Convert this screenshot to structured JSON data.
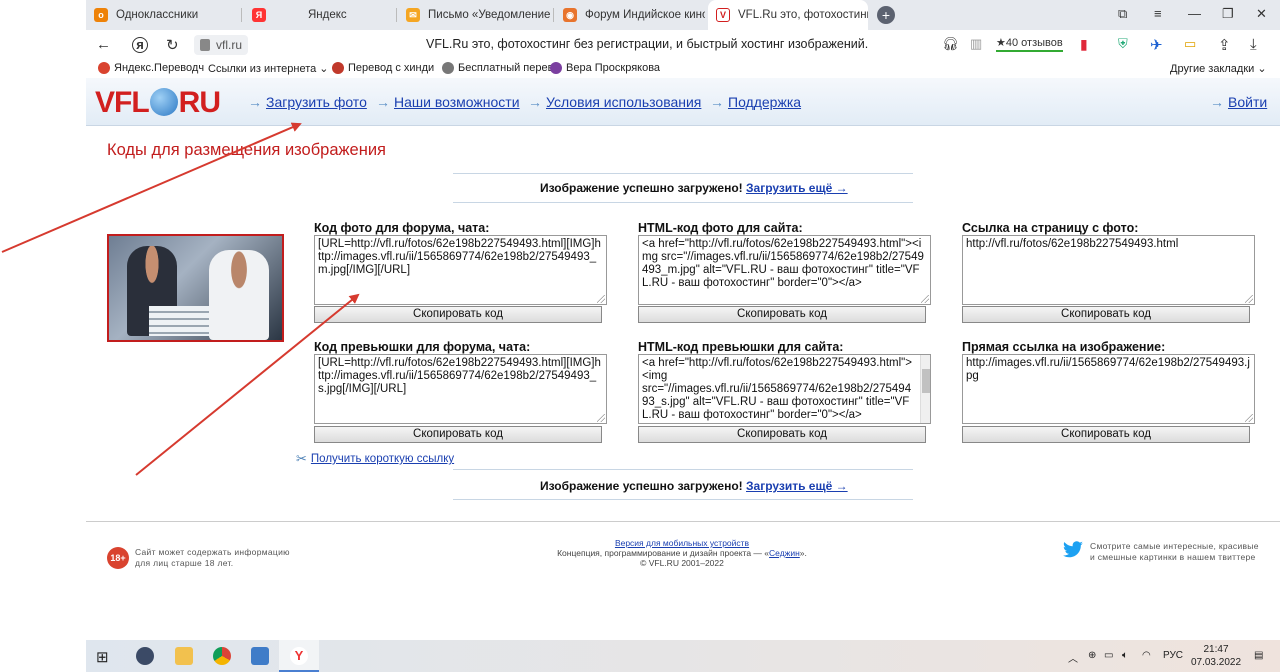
{
  "browser": {
    "tabs": [
      {
        "label": "Одноклассники",
        "icon": "ok-icon",
        "color": "#ee8208"
      },
      {
        "label": "Яндекс",
        "icon": "yandex-icon",
        "color": "#f33"
      },
      {
        "label": "Письмо «Уведомление об",
        "icon": "mail-icon",
        "color": "#f5a623"
      },
      {
        "label": "Форум Индийское кино",
        "icon": "forum-icon",
        "color": "#e8742d"
      },
      {
        "label": "VFL.Ru это, фотохостинг",
        "icon": "vfl-icon",
        "color": "#d21f1f",
        "active": true
      }
    ],
    "new_tab": "+",
    "url": "vfl.ru",
    "page_title": "VFL.Ru это, фотохостинг без регистрации, и быстрый хостинг изображений.",
    "reviews": "★40 отзывов",
    "bookmarks": [
      {
        "label": "Яндекс.Переводч",
        "color": "#d9432f"
      },
      {
        "label": "Ссылки из интернета ⌄",
        "color": ""
      },
      {
        "label": "Перевод с хинди",
        "color": "#c0392b"
      },
      {
        "label": "Бесплатный перев",
        "color": "#777"
      },
      {
        "label": "Вера Проскрякова",
        "color": "#7b3fa0"
      }
    ],
    "other_bookmarks": "Другие закладки ⌄"
  },
  "site": {
    "logo": {
      "left": "VFL",
      "right": "RU"
    },
    "nav": [
      {
        "label": "Загрузить фото"
      },
      {
        "label": "Наши возможности"
      },
      {
        "label": "Условия использования"
      },
      {
        "label": "Поддержка"
      }
    ],
    "login": "Войти",
    "heading": "Коды для размещения изображения",
    "success_text": "Изображение успешно загружено!",
    "upload_more": "Загрузить ещё →",
    "blocks": [
      {
        "label": "Код фото для форума, чата:",
        "value": "[URL=http://vfl.ru/fotos/62e198b227549493.html][IMG]http://images.vfl.ru/ii/1565869774/62e198b2/27549493_m.jpg[/IMG][/URL]",
        "button": "Скопировать код"
      },
      {
        "label": "HTML-код фото для сайта:",
        "value": "<a href=\"http://vfl.ru/fotos/62e198b227549493.html\"><img src=\"//images.vfl.ru/ii/1565869774/62e198b2/27549493_m.jpg\" alt=\"VFL.RU - ваш фотохостинг\" title=\"VFL.RU - ваш фотохостинг\" border=\"0\"></a>",
        "button": "Скопировать код"
      },
      {
        "label": "Ссылка на страницу с фото:",
        "value": "http://vfl.ru/fotos/62e198b227549493.html",
        "button": "Скопировать код"
      },
      {
        "label": "Код превьюшки для форума, чата:",
        "value": "[URL=http://vfl.ru/fotos/62e198b227549493.html][IMG]http://images.vfl.ru/ii/1565869774/62e198b2/27549493_s.jpg[/IMG][/URL]",
        "button": "Скопировать код"
      },
      {
        "label": "HTML-код превьюшки для сайта:",
        "value": "<a href=\"http://vfl.ru/fotos/62e198b227549493.html\">\n<img\nsrc=\"//images.vfl.ru/ii/1565869774/62e198b2/27549493_s.jpg\" alt=\"VFL.RU - ваш фотохостинг\" title=\"VFL.RU - ваш фотохостинг\" border=\"0\"></a>",
        "button": "Скопировать код"
      },
      {
        "label": "Прямая ссылка на изображение:",
        "value": "http://images.vfl.ru/ii/1565869774/62e198b2/27549493.jpg",
        "button": "Скопировать код"
      }
    ],
    "short_link": "Получить короткую ссылку",
    "footer": {
      "age_badge": "18+",
      "age_text": "Сайт может содержать информацию для лиц старше 18 лет.",
      "mobile_link": "Версия для мобильных устройств",
      "concept": "Концепция, программирование и дизайн проекта — «",
      "concept_link": "Седжин",
      "concept_end": "».",
      "copyright": "© VFL.RU 2001–2022",
      "twitter_text": "Смотрите самые интересные, красивые и смешные картинки в нашем твиттере"
    }
  },
  "taskbar": {
    "lang": "РУС",
    "time": "21:47",
    "date": "07.03.2022"
  },
  "colors": {
    "accent_red": "#d21f1f",
    "link_blue": "#1a3fb0",
    "annotation_arrow": "#d63a2f"
  }
}
